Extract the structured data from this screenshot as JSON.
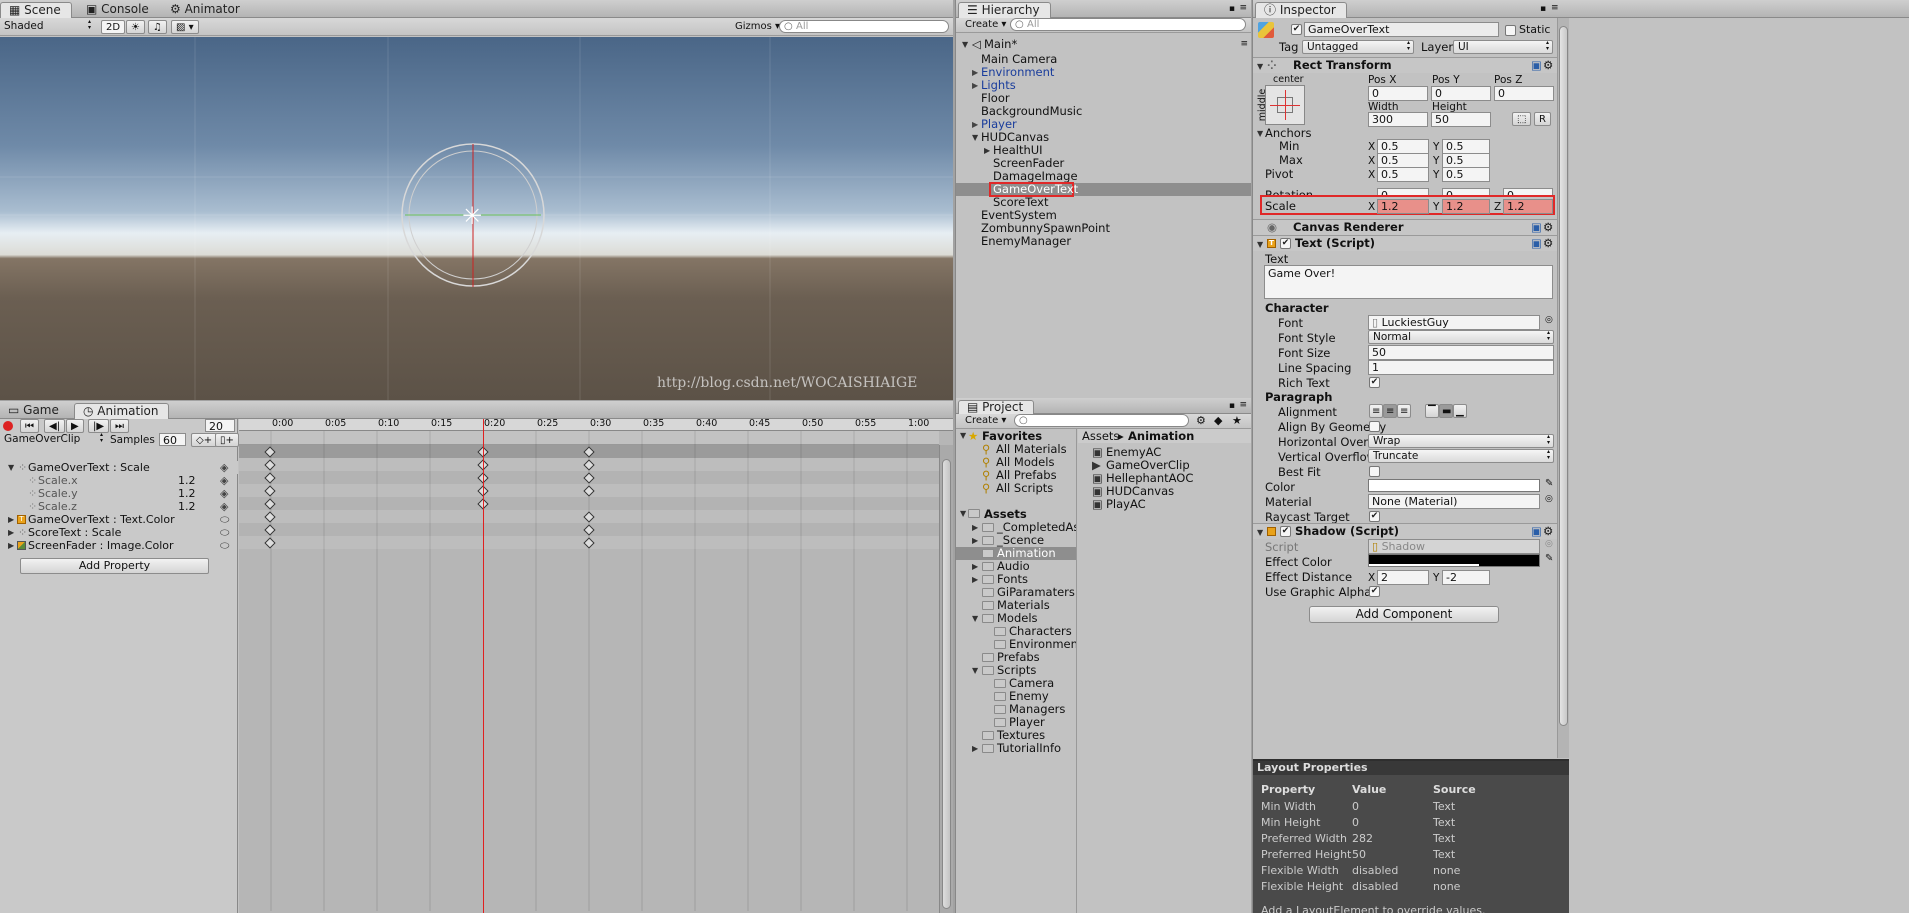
{
  "scene": {
    "tabs": [
      "Scene",
      "Console",
      "Animator"
    ],
    "shading": "Shaded",
    "mode2d": "2D",
    "gizmos": "Gizmos",
    "search": "All",
    "watermark": "http://blog.csdn.net/WOCAISHIAIGE"
  },
  "animation": {
    "tabs": [
      "Game",
      "Animation"
    ],
    "frame": "20",
    "clip": "GameOverClip",
    "samples_label": "Samples",
    "samples": "60",
    "ruler": [
      "0:00",
      "0:05",
      "0:10",
      "0:15",
      "0:20",
      "0:25",
      "0:30",
      "0:35",
      "0:40",
      "0:45",
      "0:50",
      "0:55",
      "1:00"
    ],
    "tracks": [
      {
        "name": "GameOverText : Scale",
        "value": ""
      },
      {
        "name": "Scale.x",
        "value": "1.2"
      },
      {
        "name": "Scale.y",
        "value": "1.2"
      },
      {
        "name": "Scale.z",
        "value": "1.2"
      },
      {
        "name": "GameOverText : Text.Color",
        "value": ""
      },
      {
        "name": "ScoreText : Scale",
        "value": ""
      },
      {
        "name": "ScreenFader : Image.Color",
        "value": ""
      }
    ],
    "add_property": "Add Property"
  },
  "hierarchy": {
    "tab": "Hierarchy",
    "create": "Create",
    "search": "All",
    "scene": "Main*",
    "items": [
      "Main Camera",
      "Environment",
      "Lights",
      "Floor",
      "BackgroundMusic",
      "Player",
      "HUDCanvas",
      "HealthUI",
      "ScreenFader",
      "DamageImage",
      "GameOverText",
      "ScoreText",
      "EventSystem",
      "ZombunnySpawnPoint",
      "EnemyManager"
    ]
  },
  "project": {
    "tab": "Project",
    "create": "Create",
    "favorites": "Favorites",
    "fav_items": [
      "All Materials",
      "All Models",
      "All Prefabs",
      "All Scripts"
    ],
    "assets": "Assets",
    "folders": [
      "_CompletedAssets",
      "_Scence",
      "Animation",
      "Audio",
      "Fonts",
      "GiParamaters",
      "Materials",
      "Models",
      "Characters",
      "Environment",
      "Prefabs",
      "Scripts",
      "Camera",
      "Enemy",
      "Managers",
      "Player",
      "Textures",
      "TutorialInfo"
    ],
    "breadcrumb_root": "Assets",
    "breadcrumb_current": "Animation",
    "files": [
      "EnemyAC",
      "GameOverClip",
      "HellephantAOC",
      "HUDCanvas",
      "PlayAC"
    ]
  },
  "inspector": {
    "tab": "Inspector",
    "name": "GameOverText",
    "static": "Static",
    "tag_label": "Tag",
    "tag": "Untagged",
    "layer_label": "Layer",
    "layer": "UI",
    "rect_title": "Rect Transform",
    "anchor_center": "center",
    "anchor_middle": "middle",
    "posx_label": "Pos X",
    "posy_label": "Pos Y",
    "posz_label": "Pos Z",
    "posx": "0",
    "posy": "0",
    "posz": "0",
    "width_label": "Width",
    "height_label": "Height",
    "width": "300",
    "height": "50",
    "r_btn": "R",
    "anchors": "Anchors",
    "min": "Min",
    "max": "Max",
    "pivot": "Pivot",
    "rotation": "Rotation",
    "scale": "Scale",
    "x": "X",
    "y": "Y",
    "z": "Z",
    "half": "0.5",
    "zero": "0",
    "scale_val": "1.2",
    "canvas_renderer": "Canvas Renderer",
    "text_script": "Text (Script)",
    "text_label": "Text",
    "text_value": "Game Over!",
    "character": "Character",
    "font_label": "Font",
    "font": "LuckiestGuy",
    "style_label": "Font Style",
    "style": "Normal",
    "size_label": "Font Size",
    "size": "50",
    "spacing_label": "Line Spacing",
    "spacing": "1",
    "rich_label": "Rich Text",
    "paragraph": "Paragraph",
    "align_label": "Alignment",
    "geom_label": "Align By Geometry",
    "hover_label": "Horizontal Overflow",
    "hover": "Wrap",
    "vover_label": "Vertical Overflow",
    "vover": "Truncate",
    "best_label": "Best Fit",
    "color_label": "Color",
    "material_label": "Material",
    "material": "None (Material)",
    "raycast_label": "Raycast Target",
    "shadow": "Shadow (Script)",
    "script_label": "Script",
    "script": "Shadow",
    "effect_color": "Effect Color",
    "effect_dist": "Effect Distance",
    "dist_x": "2",
    "dist_y": "-2",
    "use_alpha": "Use Graphic Alpha",
    "add_component": "Add Component"
  },
  "layout": {
    "title": "Layout Properties",
    "headers": [
      "Property",
      "Value",
      "Source"
    ],
    "rows": [
      [
        "Min Width",
        "0",
        "Text"
      ],
      [
        "Min Height",
        "0",
        "Text"
      ],
      [
        "Preferred Width",
        "282",
        "Text"
      ],
      [
        "Preferred Height",
        "50",
        "Text"
      ],
      [
        "Flexible Width",
        "disabled",
        "none"
      ],
      [
        "Flexible Height",
        "disabled",
        "none"
      ]
    ],
    "footer": "Add a LayoutElement to override values."
  }
}
